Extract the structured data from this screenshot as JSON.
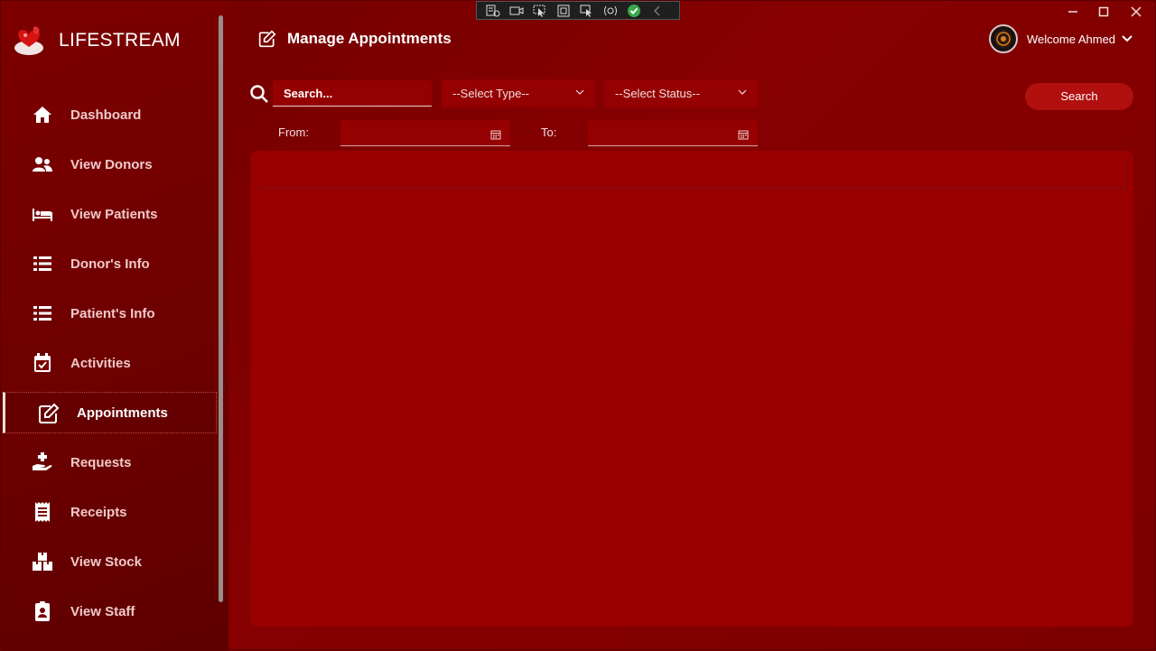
{
  "app": {
    "title": "LIFESTREAM"
  },
  "sidebar": {
    "items": [
      {
        "label": "Dashboard",
        "icon": "home-icon"
      },
      {
        "label": "View Donors",
        "icon": "users-icon"
      },
      {
        "label": "View Patients",
        "icon": "bed-icon"
      },
      {
        "label": "Donor's Info",
        "icon": "list-icon"
      },
      {
        "label": "Patient's Info",
        "icon": "list-icon"
      },
      {
        "label": "Activities",
        "icon": "calendar-check-icon"
      },
      {
        "label": "Appointments",
        "icon": "edit-icon",
        "active": true
      },
      {
        "label": "Requests",
        "icon": "hand-plus-icon"
      },
      {
        "label": "Receipts",
        "icon": "receipt-icon"
      },
      {
        "label": "View Stock",
        "icon": "boxes-icon"
      },
      {
        "label": "View Staff",
        "icon": "id-badge-icon"
      }
    ]
  },
  "header": {
    "page_title": "Manage Appointments",
    "welcome": "Welcome Ahmed"
  },
  "filters": {
    "search_placeholder": "Search...",
    "type_select": "--Select Type--",
    "status_select": "--Select Status--",
    "from_label": "From:",
    "to_label": "To:",
    "search_button": "Search"
  },
  "colors": {
    "background": "#7a0000",
    "panel": "#980000",
    "button": "#b20f0f",
    "input": "#950000"
  }
}
